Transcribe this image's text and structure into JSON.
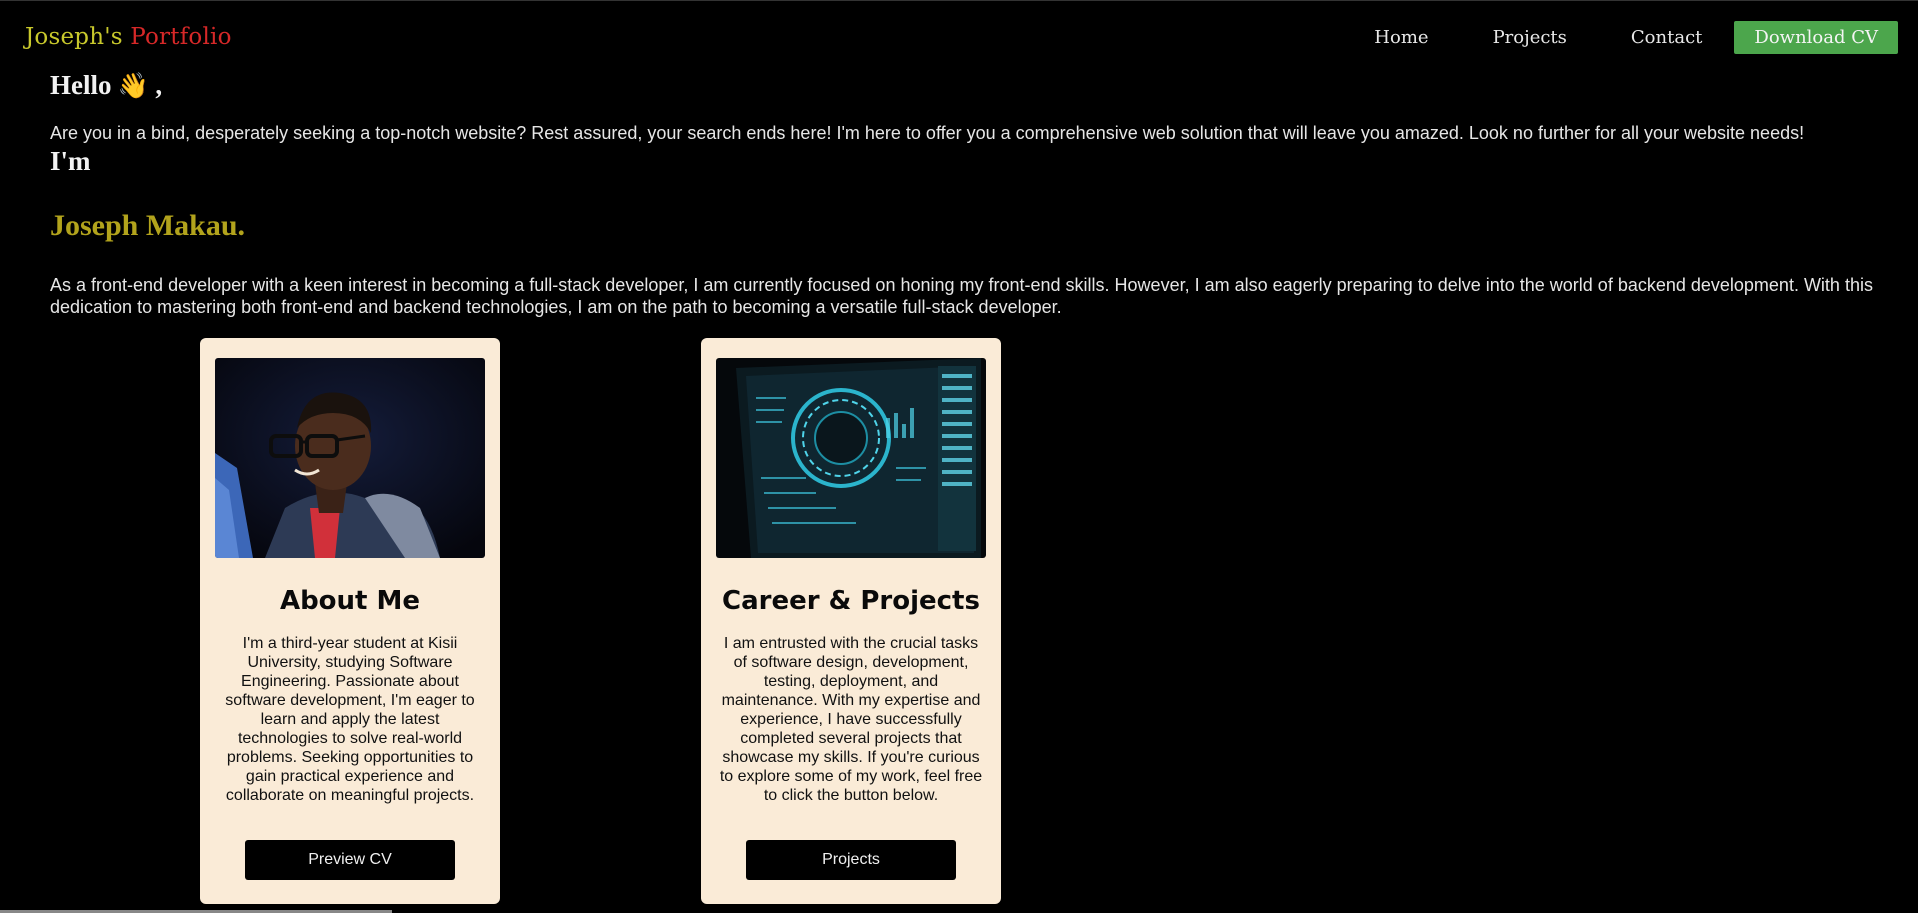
{
  "brand": {
    "first": "Joseph's",
    "second": "Portfolio"
  },
  "nav": {
    "home": "Home",
    "projects": "Projects",
    "contact": "Contact",
    "download_cv": "Download CV"
  },
  "hero": {
    "hello": "Hello",
    "wave": "👋",
    "hello_suffix": ",",
    "intro": "Are you in a bind, desperately seeking a top-notch website? Rest assured, your search ends here! I'm here to offer you a comprehensive web solution that will leave you amazed. Look no further for all your website needs!",
    "im": "I'm",
    "name": "Joseph Makau.",
    "bio": "As a front-end developer with a keen interest in becoming a full-stack developer, I am currently focused on honing my front-end skills. However, I am also eagerly preparing to delve into the world of backend development. With this dedication to mastering both front-end and backend technologies, I am on the path to becoming a versatile full-stack developer."
  },
  "cards": {
    "about": {
      "title": "About Me",
      "text": "I'm a third-year student at Kisii University, studying Software Engineering. Passionate about software development, I'm eager to learn and apply the latest technologies to solve real-world problems. Seeking opportunities to gain practical experience and collaborate on meaningful projects.",
      "button": "Preview CV"
    },
    "career": {
      "title": "Career & Projects",
      "text": "I am entrusted with the crucial tasks of software design, development, testing, deployment, and maintenance. With my expertise and experience, I have successfully completed several projects that showcase my skills. If you're curious to explore some of my work, feel free to click the button below.",
      "button": "Projects"
    }
  },
  "colors": {
    "background": "#000000",
    "brand_first": "#c9c92c",
    "brand_second": "#d62828",
    "name_gold": "#b2a31c",
    "cv_button": "#4ca64c",
    "card_bg": "#faebd7"
  }
}
